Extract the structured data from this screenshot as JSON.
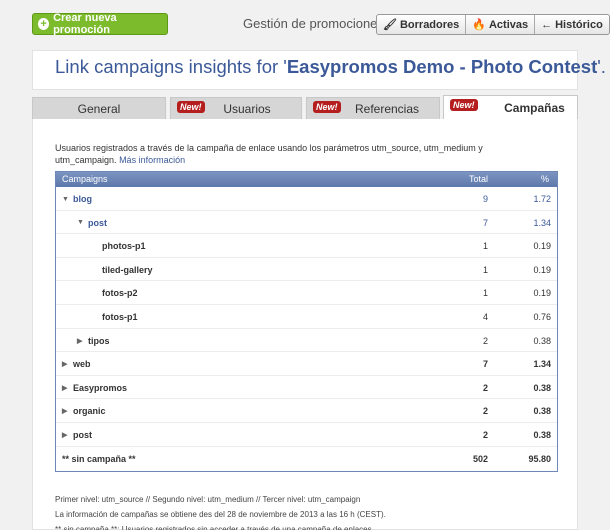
{
  "topbar": {
    "create_label": "Crear nueva promoción",
    "section_label": "Gestión de promociones",
    "buttons": [
      {
        "label": "Borradores",
        "icon": "paint-roller-icon"
      },
      {
        "label": "Activas",
        "icon": "flame-icon"
      },
      {
        "label": "Histórico",
        "icon": "back-arrow-icon"
      }
    ]
  },
  "title": {
    "prefix": "Link campaigns insights for '",
    "name": "Easypromos Demo - Photo Contest",
    "suffix": "'."
  },
  "tabs": [
    {
      "label": "General",
      "badge": ""
    },
    {
      "label": "Usuarios",
      "badge": "New!"
    },
    {
      "label": "Referencias",
      "badge": "New!"
    },
    {
      "label": "Campañas",
      "badge": "New!",
      "active": true
    }
  ],
  "intro": {
    "text": "Usuarios registrados a través de la campaña de enlace usando los parámetros utm_source, utm_medium y utm_campaign.",
    "link": "Más información"
  },
  "table": {
    "headers": [
      "Campaigns",
      "Total",
      "%"
    ],
    "rows": [
      {
        "name": "blog",
        "total": "9",
        "pct": "1.72",
        "indent": 0,
        "toggle": "expanded"
      },
      {
        "name": "post",
        "total": "7",
        "pct": "1.34",
        "indent": 1,
        "toggle": "expanded"
      },
      {
        "name": "photos-p1",
        "total": "1",
        "pct": "0.19",
        "indent": 2,
        "toggle": "none"
      },
      {
        "name": "tiled-gallery",
        "total": "1",
        "pct": "0.19",
        "indent": 2,
        "toggle": "none"
      },
      {
        "name": "fotos-p2",
        "total": "1",
        "pct": "0.19",
        "indent": 2,
        "toggle": "none"
      },
      {
        "name": "fotos-p1",
        "total": "4",
        "pct": "0.76",
        "indent": 2,
        "toggle": "none"
      },
      {
        "name": "tipos",
        "total": "2",
        "pct": "0.38",
        "indent": 1,
        "toggle": "collapsed"
      },
      {
        "name": "web",
        "total": "7",
        "pct": "1.34",
        "indent": 0,
        "toggle": "collapsed"
      },
      {
        "name": "Easypromos",
        "total": "2",
        "pct": "0.38",
        "indent": 0,
        "toggle": "collapsed"
      },
      {
        "name": "organic",
        "total": "2",
        "pct": "0.38",
        "indent": 0,
        "toggle": "collapsed"
      },
      {
        "name": "post",
        "total": "2",
        "pct": "0.38",
        "indent": 0,
        "toggle": "collapsed"
      },
      {
        "name": "** sin campaña **",
        "total": "502",
        "pct": "95.80",
        "indent": 0,
        "toggle": "none"
      }
    ]
  },
  "footer": [
    "Primer nivel: utm_source // Segundo nivel: utm_medium // Tercer nivel: utm_campaign",
    "La información de campañas se obtiene des del 28 de noviembre de 2013 a las 16 h (CEST).",
    "** sin campaña **: Usuarios registrados sin acceder a través de una campaña de enlaces."
  ],
  "colors": {
    "accent_green": "#7cbb2b",
    "link_blue": "#3b5998",
    "header_blue": "#6d87b7",
    "badge_red": "#b51e1e"
  }
}
